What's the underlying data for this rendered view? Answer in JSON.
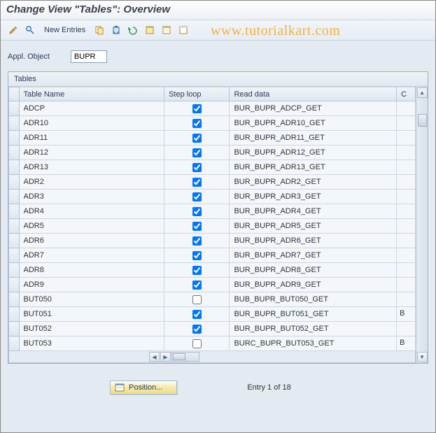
{
  "title": "Change View \"Tables\": Overview",
  "watermark": "www.tutorialkart.com",
  "toolbar": {
    "new_entries": "New Entries"
  },
  "appl_object": {
    "label": "Appl. Object",
    "value": "BUPR"
  },
  "grid": {
    "title": "Tables",
    "columns": {
      "name": "Table Name",
      "step": "Step loop",
      "read": "Read data",
      "c": "C"
    },
    "rows": [
      {
        "name": "ADCP",
        "step": true,
        "read": "BUR_BUPR_ADCP_GET",
        "c": ""
      },
      {
        "name": "ADR10",
        "step": true,
        "read": "BUR_BUPR_ADR10_GET",
        "c": ""
      },
      {
        "name": "ADR11",
        "step": true,
        "read": "BUR_BUPR_ADR11_GET",
        "c": ""
      },
      {
        "name": "ADR12",
        "step": true,
        "read": "BUR_BUPR_ADR12_GET",
        "c": ""
      },
      {
        "name": "ADR13",
        "step": true,
        "read": "BUR_BUPR_ADR13_GET",
        "c": ""
      },
      {
        "name": "ADR2",
        "step": true,
        "read": "BUR_BUPR_ADR2_GET",
        "c": ""
      },
      {
        "name": "ADR3",
        "step": true,
        "read": "BUR_BUPR_ADR3_GET",
        "c": ""
      },
      {
        "name": "ADR4",
        "step": true,
        "read": "BUR_BUPR_ADR4_GET",
        "c": ""
      },
      {
        "name": "ADR5",
        "step": true,
        "read": "BUR_BUPR_ADR5_GET",
        "c": ""
      },
      {
        "name": "ADR6",
        "step": true,
        "read": "BUR_BUPR_ADR6_GET",
        "c": ""
      },
      {
        "name": "ADR7",
        "step": true,
        "read": "BUR_BUPR_ADR7_GET",
        "c": ""
      },
      {
        "name": "ADR8",
        "step": true,
        "read": "BUR_BUPR_ADR8_GET",
        "c": ""
      },
      {
        "name": "ADR9",
        "step": true,
        "read": "BUR_BUPR_ADR9_GET",
        "c": ""
      },
      {
        "name": "BUT050",
        "step": false,
        "read": "BUB_BUPR_BUT050_GET",
        "c": ""
      },
      {
        "name": "BUT051",
        "step": true,
        "read": "BUR_BUPR_BUT051_GET",
        "c": "B"
      },
      {
        "name": "BUT052",
        "step": true,
        "read": "BUR_BUPR_BUT052_GET",
        "c": ""
      },
      {
        "name": "BUT053",
        "step": false,
        "read": "BURC_BUPR_BUT053_GET",
        "c": "B"
      }
    ]
  },
  "footer": {
    "position_label": "Position...",
    "entry_text": "Entry 1 of 18"
  }
}
